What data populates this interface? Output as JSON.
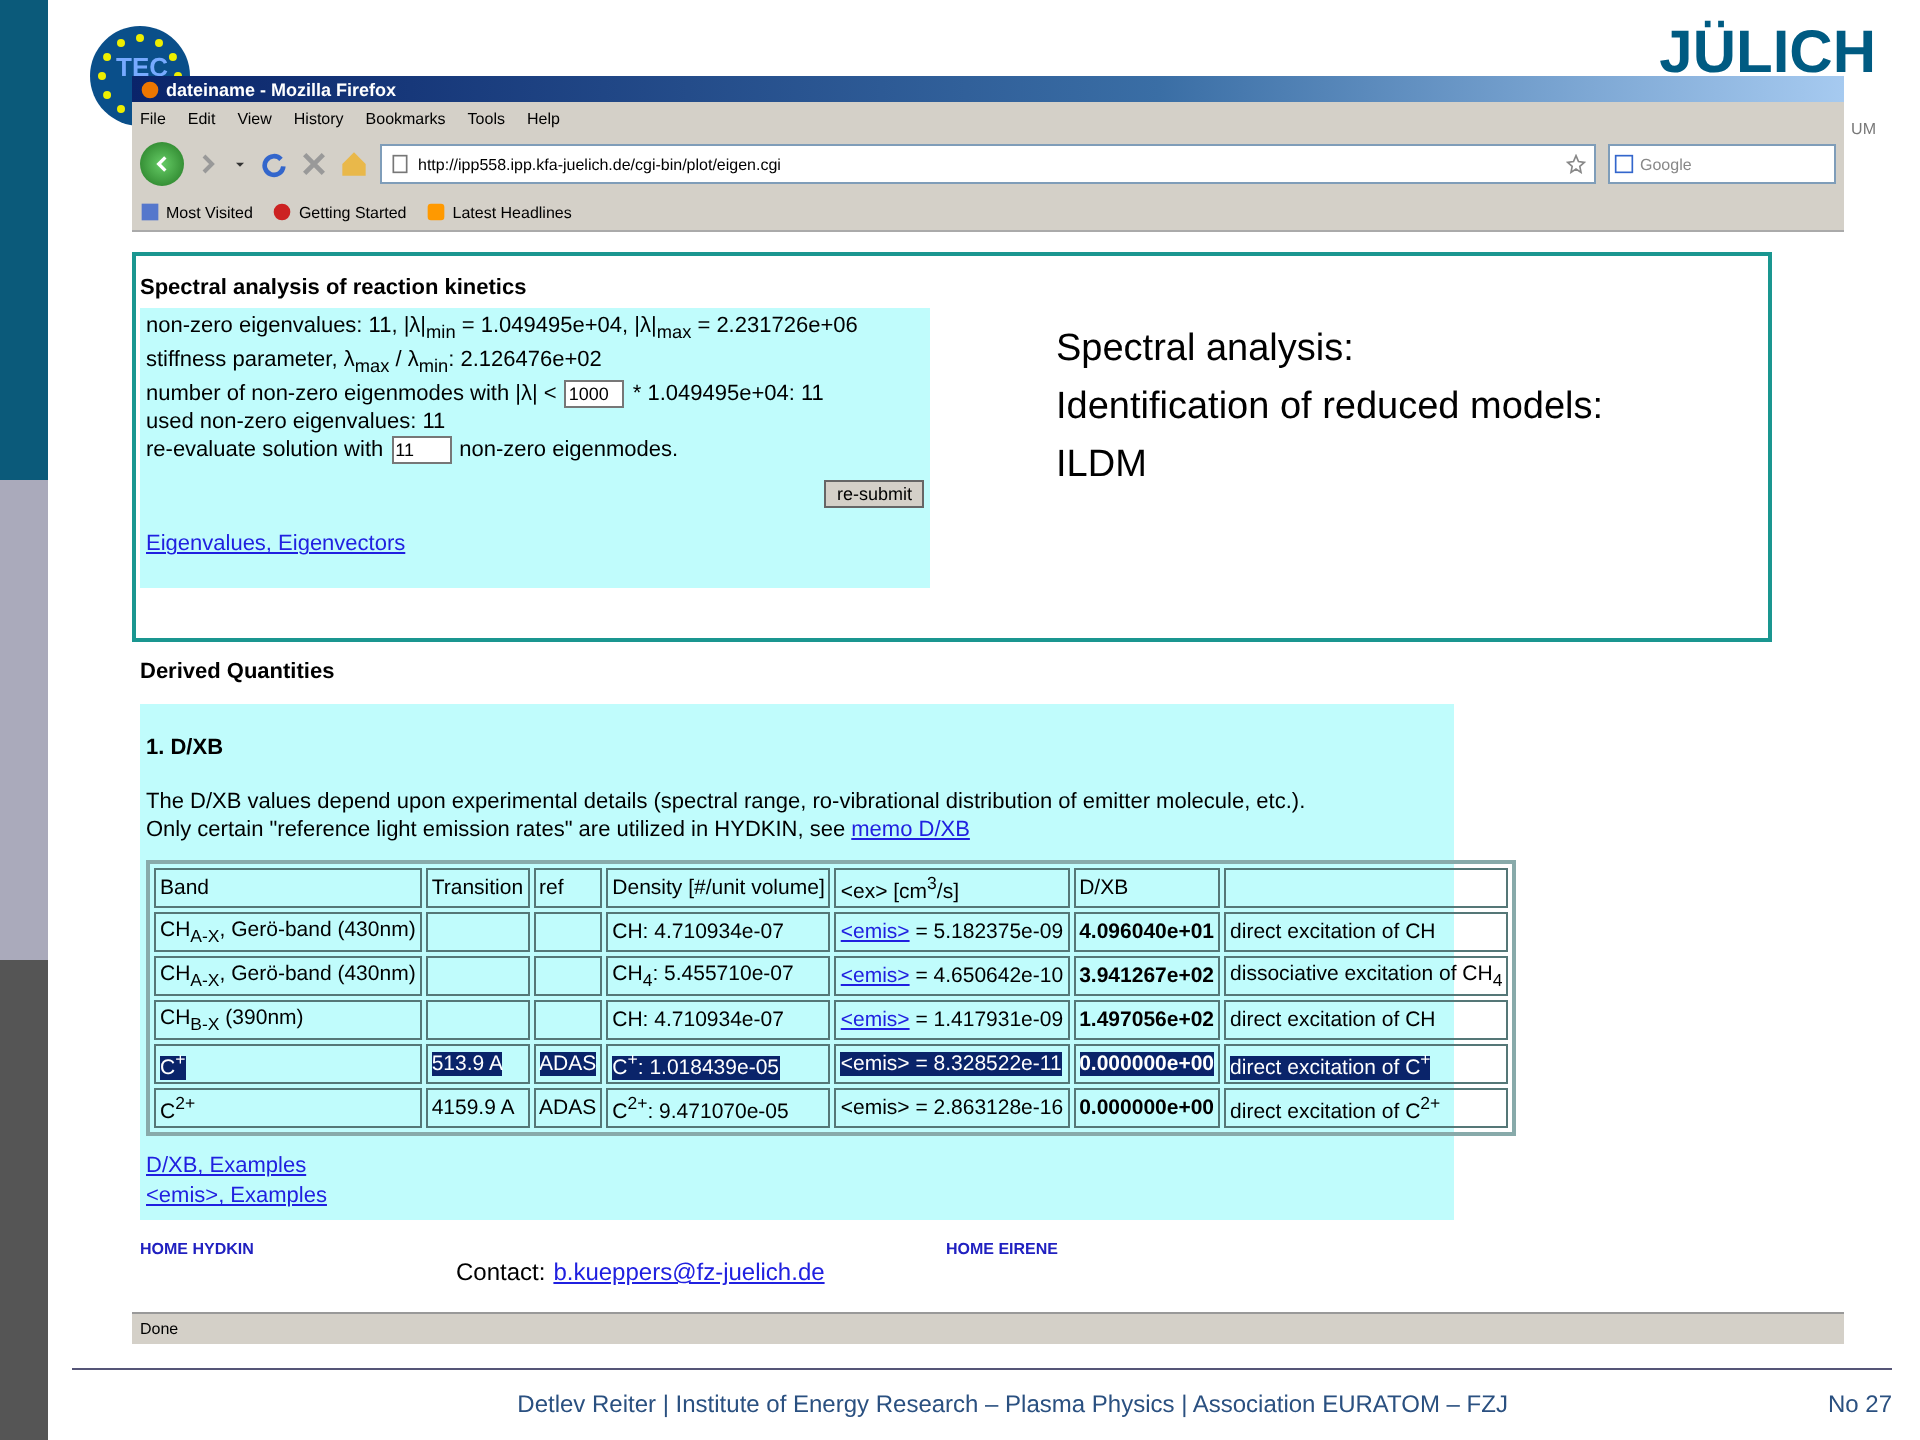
{
  "slide": {
    "logo_left": "TEC",
    "logo_right": {
      "name": "JÜLICH",
      "subtitle": "UM"
    }
  },
  "browser": {
    "title": "dateiname - Mozilla Firefox",
    "menu": [
      "File",
      "Edit",
      "View",
      "History",
      "Bookmarks",
      "Tools",
      "Help"
    ],
    "url": "http://ipp558.ipp.kfa-juelich.de/cgi-bin/plot/eigen.cgi",
    "search_placeholder": "Google",
    "bookmarks": [
      {
        "kind": "site",
        "label": "Most Visited"
      },
      {
        "kind": "start",
        "label": "Getting Started"
      },
      {
        "kind": "feed",
        "label": "Latest Headlines"
      }
    ],
    "status": "Done"
  },
  "spectral": {
    "heading": "Spectral analysis of reaction kinetics",
    "lines": [
      {
        "text": "non-zero eigenvalues: 11, |λ|$_{min}$ = 1.049495e+04, |λ|$_{max}$ = 2.231726e+06"
      },
      {
        "text": "stiffness parameter, λ$_{max}$ / λ$_{min}$: 2.126476e+02"
      },
      {
        "text": "number of non-zero eigenmodes with |λ| <",
        "input": "1000",
        "after": "* 1.049495e+04: 11"
      },
      {
        "text": "used non-zero eigenvalues: 11"
      },
      {
        "text": "re-evaluate solution with",
        "input": "11",
        "after": "non-zero eigenmodes."
      }
    ],
    "button": "re-submit",
    "link": "Eigenvalues, Eigenvectors"
  },
  "annotation": [
    "Spectral analysis:",
    "Identification of reduced models:",
    "ILDM"
  ],
  "derived": {
    "heading": "Derived Quantities",
    "section": "1. D/XB",
    "intro": [
      "The D/XB values depend upon experimental details (spectral range, ro-vibrational distribution of emitter molecule, etc.)."
    ],
    "intro2": {
      "text": "Only certain \"reference light emission rates\" are utilized in HYDKIN, see",
      "link": "memo D/XB"
    },
    "columns": [
      {
        "label": "Band",
        "bold": false
      },
      {
        "label": "Transition",
        "bold": false
      },
      {
        "label": "ref",
        "bold": false
      },
      {
        "label": "Density [#/unit volume]",
        "bold": false
      },
      {
        "label": "<ex> [cm$^{3}$/s]",
        "bold": false
      },
      {
        "label": "D/XB",
        "bold": true
      },
      {
        "bold": false
      }
    ],
    "rows": [
      {
        "selected": false,
        "cells": [
          {
            "text": "CH$_{A-X}$, Gerö-band (430nm)"
          },
          {},
          {},
          {
            "text": "CH: 4.710934e-07"
          },
          {
            "link": "<emis>",
            "text": " = 5.182375e-09"
          },
          {
            "text": "4.096040e+01"
          },
          {
            "text": "direct excitation of CH"
          }
        ]
      },
      {
        "selected": false,
        "cells": [
          {
            "text": "CH$_{A-X}$, Gerö-band (430nm)"
          },
          {},
          {},
          {
            "text": "CH$_{4}$: 5.455710e-07"
          },
          {
            "link": "<emis>",
            "text": " = 4.650642e-10"
          },
          {
            "text": "3.941267e+02"
          },
          {
            "text": "dissociative excitation of CH$_{4}$"
          }
        ]
      },
      {
        "selected": false,
        "cells": [
          {
            "text": "CH$_{B-X}$ (390nm)"
          },
          {},
          {},
          {
            "text": "CH: 4.710934e-07"
          },
          {
            "link": "<emis>",
            "text": " = 1.417931e-09"
          },
          {
            "text": "1.497056e+02"
          },
          {
            "text": "direct excitation of CH"
          }
        ]
      },
      {
        "selected": true,
        "cells": [
          {
            "text": "C$^{+}$"
          },
          {
            "text": "513.9 A"
          },
          {
            "text": "ADAS"
          },
          {
            "text": "C$^{+}$: 1.018439e-05"
          },
          {
            "text": "<emis> = 8.328522e-11"
          },
          {
            "text": "0.000000e+00"
          },
          {
            "text": "direct excitation of C$^{+}$"
          }
        ]
      },
      {
        "selected": false,
        "cells": [
          {
            "text": "C$^{2+}$"
          },
          {
            "text": "4159.9 A"
          },
          {
            "text": "ADAS"
          },
          {
            "text": "C$^{2+}$: 9.471070e-05"
          },
          {
            "text": "<emis> = 2.863128e-16"
          },
          {
            "text": "0.000000e+00"
          },
          {
            "text": "direct excitation of C$^{2+}$"
          }
        ]
      }
    ],
    "links": [
      "D/XB, Examples",
      "<emis>, Examples"
    ]
  },
  "page_footer": {
    "home_links": [
      "HOME HYDKIN",
      "HOME EIRENE"
    ],
    "contact_label": "Contact:",
    "contact_email": "b.kueppers@fz-juelich.de"
  },
  "footer": {
    "credit": "Detlev Reiter | Institute of Energy Research – Plasma Physics | Association EURATOM – FZJ",
    "page": "No 27"
  }
}
